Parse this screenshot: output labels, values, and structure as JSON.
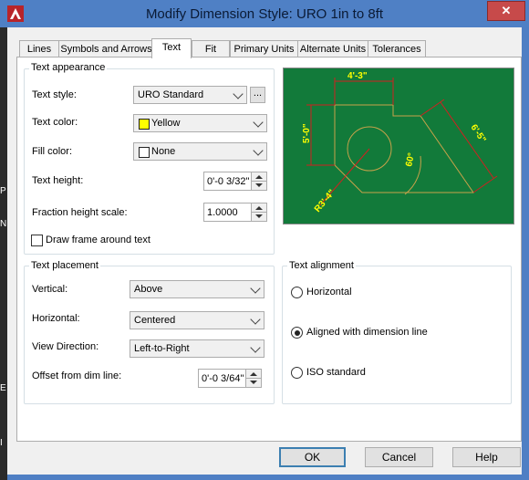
{
  "window": {
    "title": "Modify Dimension Style: URO 1in to 8ft",
    "close_label": "✕"
  },
  "tabs": [
    {
      "label": "Lines"
    },
    {
      "label": "Symbols and Arrows"
    },
    {
      "label": "Text",
      "active": true
    },
    {
      "label": "Fit"
    },
    {
      "label": "Primary Units"
    },
    {
      "label": "Alternate Units"
    },
    {
      "label": "Tolerances"
    }
  ],
  "text_appearance": {
    "title": "Text appearance",
    "text_style_label": "Text style:",
    "text_style_value": "URO Standard",
    "browse_label": "...",
    "text_color_label": "Text color:",
    "text_color_value": "Yellow",
    "text_color_swatch": "#ffff00",
    "fill_color_label": "Fill color:",
    "fill_color_value": "None",
    "fill_color_swatch": "#ffffff",
    "text_height_label": "Text height:",
    "text_height_value": "0'-0 3/32\"",
    "fraction_label": "Fraction height scale:",
    "fraction_value": "1.0000",
    "draw_frame_label": "Draw frame around text",
    "draw_frame_checked": false
  },
  "text_placement": {
    "title": "Text placement",
    "vertical_label": "Vertical:",
    "vertical_value": "Above",
    "horizontal_label": "Horizontal:",
    "horizontal_value": "Centered",
    "view_direction_label": "View Direction:",
    "view_direction_value": "Left-to-Right",
    "offset_label": "Offset from dim line:",
    "offset_value": "0'-0 3/64\""
  },
  "text_alignment": {
    "title": "Text alignment",
    "options": [
      {
        "label": "Horizontal",
        "selected": false
      },
      {
        "label": "Aligned with dimension line",
        "selected": true
      },
      {
        "label": "ISO standard",
        "selected": false
      }
    ]
  },
  "preview": {
    "background": "#127a3a",
    "dim_top": "4'-3\"",
    "dim_left": "5'-0\"",
    "dim_right": "6'-5\"",
    "dim_angle": "60°",
    "dim_radius": "R3'-4\""
  },
  "buttons": {
    "ok": "OK",
    "cancel": "Cancel",
    "help": "Help"
  },
  "background_fragments": [
    "P",
    "N",
    "E",
    "I"
  ]
}
